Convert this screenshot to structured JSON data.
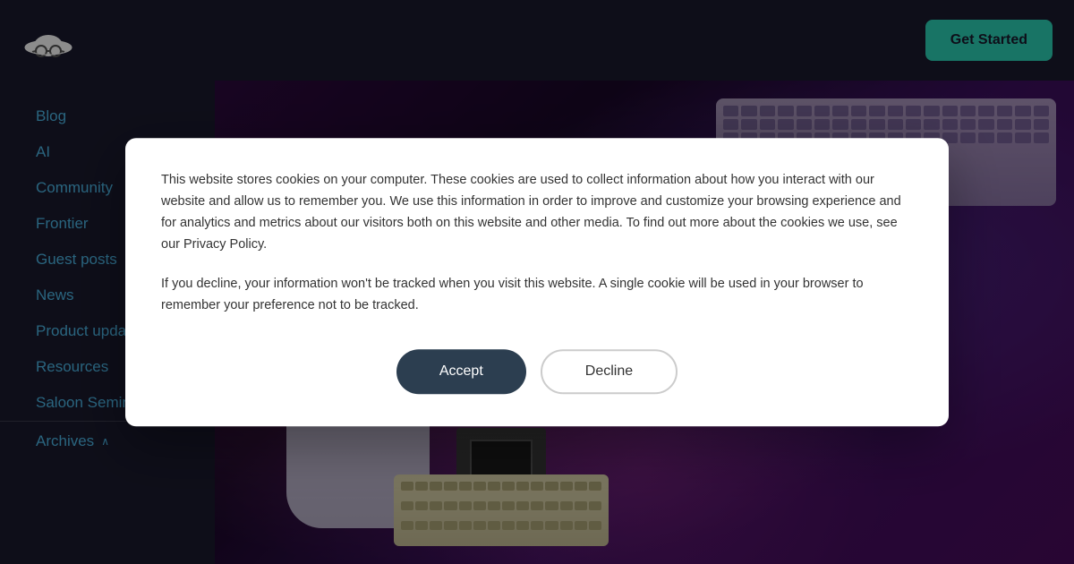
{
  "navbar": {
    "logo_alt": "Hat logo",
    "get_started_label": "Get Started"
  },
  "sidebar": {
    "items": [
      {
        "id": "blog",
        "label": "Blog"
      },
      {
        "id": "ai",
        "label": "AI"
      },
      {
        "id": "community",
        "label": "Community"
      },
      {
        "id": "frontier",
        "label": "Frontier"
      },
      {
        "id": "guest-posts",
        "label": "Guest posts"
      },
      {
        "id": "news",
        "label": "News"
      },
      {
        "id": "product-updates",
        "label": "Product updates"
      },
      {
        "id": "resources",
        "label": "Resources"
      },
      {
        "id": "saloon-seminars",
        "label": "Saloon Seminars"
      },
      {
        "id": "archives",
        "label": "Archives"
      }
    ]
  },
  "cookie": {
    "text_primary": "This website stores cookies on your computer. These cookies are used to collect information about how you interact with our website and allow us to remember you. We use this information in order to improve and customize your browsing experience and for analytics and metrics about our visitors both on this website and other media. To find out more about the cookies we use, see our Privacy Policy.",
    "text_secondary": "If you decline, your information won't be tracked when you visit this website. A single cookie will be used in your browser to remember your preference not to be tracked.",
    "accept_label": "Accept",
    "decline_label": "Decline"
  },
  "icons": {
    "chevron": "∧",
    "hat_emoji": "🤠"
  }
}
